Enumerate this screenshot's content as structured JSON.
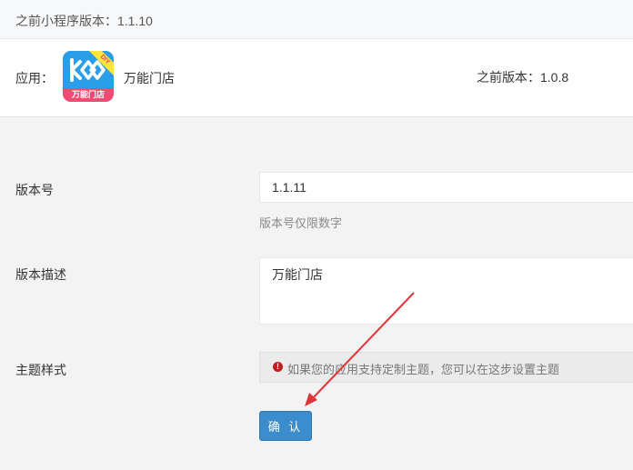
{
  "header": {
    "title": "之前小程序版本：1.1.10"
  },
  "app": {
    "label": "应用：",
    "logo_ribbon": "DIY",
    "logo_text": "万能门店",
    "name": "万能门店",
    "previous_version": "之前版本：1.0.8"
  },
  "form": {
    "version": {
      "label": "版本号",
      "value": "1.1.11",
      "hint": "版本号仅限数字"
    },
    "description": {
      "label": "版本描述",
      "value": "万能门店"
    },
    "theme": {
      "label": "主题样式",
      "notice_icon": "exclamation-circle-icon",
      "notice": "如果您的应用支持定制主题，您可以在这步设置主题"
    },
    "confirm_label": "确 认"
  },
  "colors": {
    "primary_button": "#3c8dcd",
    "arrow": "#e0343b",
    "logo_blue": "#2b9ee9",
    "logo_pink": "#f24b72"
  }
}
